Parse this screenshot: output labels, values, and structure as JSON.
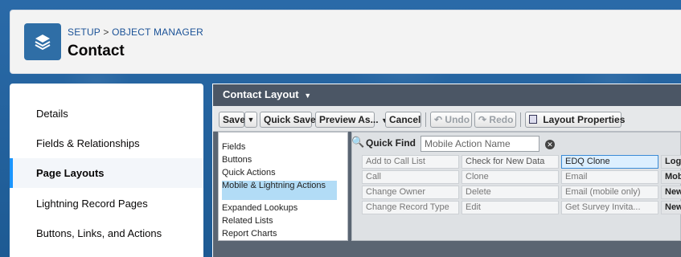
{
  "header": {
    "breadcrumb": [
      "SETUP",
      "OBJECT MANAGER"
    ],
    "separator": ">",
    "title": "Contact",
    "icon": "layers-icon"
  },
  "nav": {
    "items": [
      {
        "label": "Details",
        "active": false
      },
      {
        "label": "Fields & Relationships",
        "active": false
      },
      {
        "label": "Page Layouts",
        "active": true
      },
      {
        "label": "Lightning Record Pages",
        "active": false
      },
      {
        "label": "Buttons, Links, and Actions",
        "active": false
      }
    ]
  },
  "layout": {
    "title": "Contact Layout",
    "toolbar": {
      "save": "Save",
      "quick_save": "Quick Save",
      "preview_as": "Preview As...",
      "cancel": "Cancel",
      "undo": "Undo",
      "redo": "Redo",
      "layout_properties": "Layout Properties"
    },
    "categories": [
      {
        "label": "Fields",
        "selected": false
      },
      {
        "label": "Buttons",
        "selected": false
      },
      {
        "label": "Quick Actions",
        "selected": false
      },
      {
        "label": "Mobile & Lightning Actions",
        "selected": true
      },
      {
        "label": "Expanded Lookups",
        "selected": false
      },
      {
        "label": "Related Lists",
        "selected": false
      },
      {
        "label": "Report Charts",
        "selected": false
      }
    ],
    "quick_find": {
      "label": "Quick Find",
      "placeholder": "Mobile Action Name"
    },
    "grid": [
      [
        "Add to Call List",
        "Check for New Data",
        "EDQ Clone",
        "Log a"
      ],
      [
        "Call",
        "Clone",
        "Email",
        "Mobi"
      ],
      [
        "Change Owner",
        "Delete",
        "Email (mobile only)",
        "New A"
      ],
      [
        "Change Record Type",
        "Edit",
        "Get Survey Invita...",
        "New C"
      ]
    ]
  },
  "colors": {
    "accent": "#1b96ff",
    "header_bar": "#4b5665",
    "icon_bg": "#2f6ea6"
  }
}
